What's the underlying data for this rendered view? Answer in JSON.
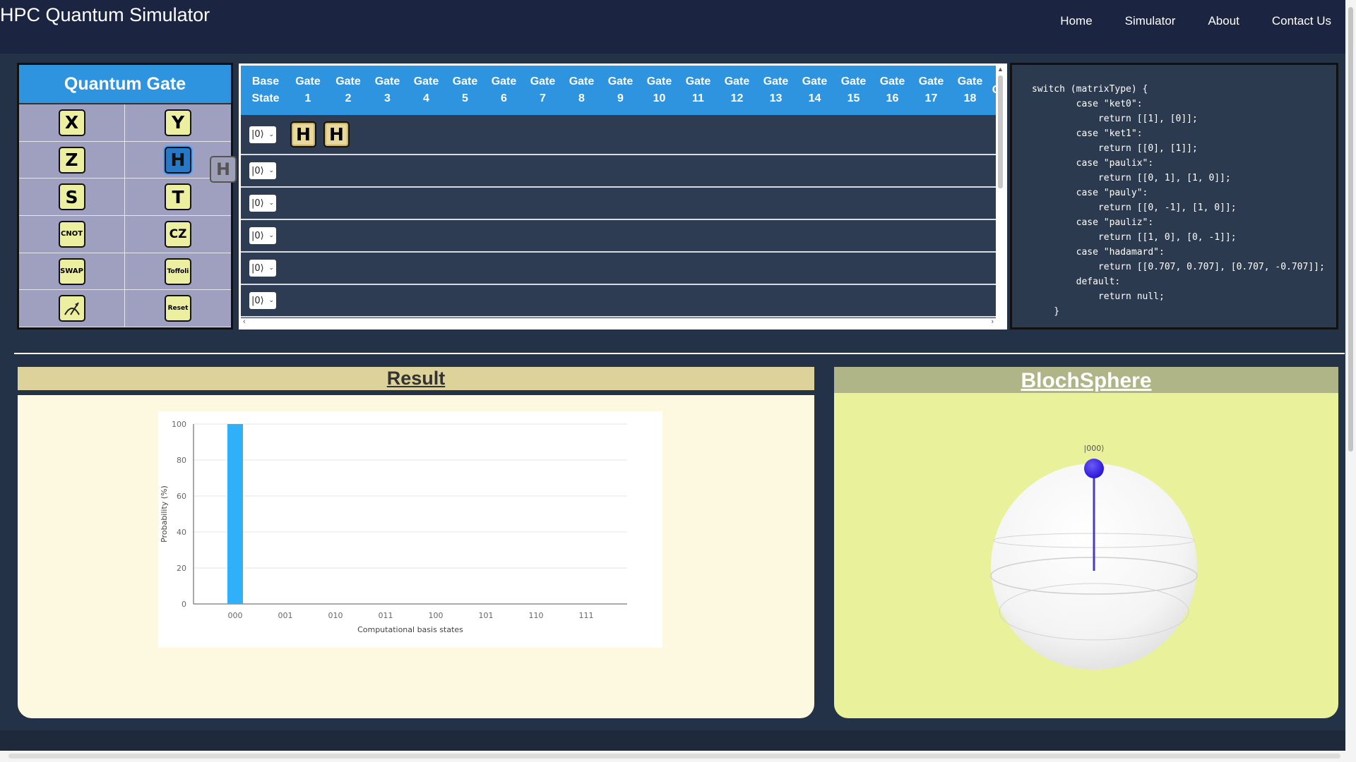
{
  "app": {
    "title": "HPC Quantum Simulator"
  },
  "nav": [
    "Home",
    "Simulator",
    "About",
    "Contact Us"
  ],
  "palette": {
    "title": "Quantum Gate",
    "gates": [
      "X",
      "Y",
      "Z",
      "H",
      "S",
      "T",
      "CNOT",
      "CZ",
      "SWAP",
      "Toffoli",
      "measure-icon",
      "Reset"
    ],
    "dragging_gate": "H"
  },
  "circuit": {
    "headers": [
      [
        "Base",
        "State"
      ],
      [
        "Gate",
        "1"
      ],
      [
        "Gate",
        "2"
      ],
      [
        "Gate",
        "3"
      ],
      [
        "Gate",
        "4"
      ],
      [
        "Gate",
        "5"
      ],
      [
        "Gate",
        "6"
      ],
      [
        "Gate",
        "7"
      ],
      [
        "Gate",
        "8"
      ],
      [
        "Gate",
        "9"
      ],
      [
        "Gate",
        "10"
      ],
      [
        "Gate",
        "11"
      ],
      [
        "Gate",
        "12"
      ],
      [
        "Gate",
        "13"
      ],
      [
        "Gate",
        "14"
      ],
      [
        "Gate",
        "15"
      ],
      [
        "Gate",
        "16"
      ],
      [
        "Gate",
        "17"
      ],
      [
        "Gate",
        "18"
      ],
      [
        "G",
        ""
      ]
    ],
    "rows": [
      {
        "state": "|0⟩",
        "gates": [
          "H",
          "H"
        ]
      },
      {
        "state": "|0⟩",
        "gates": []
      },
      {
        "state": "|0⟩",
        "gates": []
      },
      {
        "state": "|0⟩",
        "gates": []
      },
      {
        "state": "|0⟩",
        "gates": []
      },
      {
        "state": "|0⟩",
        "gates": []
      }
    ]
  },
  "code": "switch (matrixType) {\n        case \"ket0\":\n            return [[1], [0]];\n        case \"ket1\":\n            return [[0], [1]];\n        case \"paulix\":\n            return [[0, 1], [1, 0]];\n        case \"pauly\":\n            return [[0, -1], [1, 0]];\n        case \"pauliz\":\n            return [[1, 0], [0, -1]];\n        case \"hadamard\":\n            return [[0.707, 0.707], [0.707, -0.707]];\n        default:\n            return null;\n    }",
  "result": {
    "title": "Result"
  },
  "bloch": {
    "title": "BlochSphere",
    "state_label": "|000⟩"
  },
  "chart_data": {
    "type": "bar",
    "categories": [
      "000",
      "001",
      "010",
      "011",
      "100",
      "101",
      "110",
      "111"
    ],
    "values": [
      100,
      0,
      0,
      0,
      0,
      0,
      0,
      0
    ],
    "xlabel": "Computational basis states",
    "ylabel": "Probability (%)",
    "ylim": [
      0,
      100
    ],
    "yticks": [
      0,
      20,
      40,
      60,
      80,
      100
    ],
    "grid": true,
    "bar_color": "#2fb0f8"
  }
}
